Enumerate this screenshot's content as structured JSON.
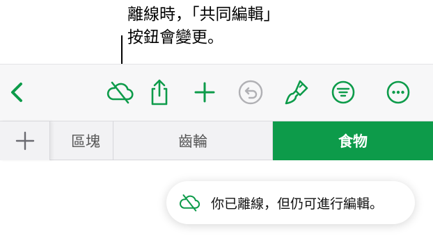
{
  "callout": {
    "line1": "離線時，「共同編輯」",
    "line2": "按鈕會變更。"
  },
  "toolbar": {
    "icons": {
      "back": "chevron-left-icon",
      "collaborate_offline": "cloud-slash-icon",
      "share": "share-icon",
      "add": "plus-icon",
      "undo": "undo-icon",
      "format": "paintbrush-icon",
      "organize": "filter-lines-icon",
      "more": "ellipsis-circle-icon"
    },
    "accent_color": "#0d9b4a",
    "disabled_color": "#b0b0b4"
  },
  "tabs": {
    "add_icon": "plus-icon",
    "items": [
      {
        "label": "區塊",
        "partial": true
      },
      {
        "label": "齒輪"
      },
      {
        "label": "食物",
        "selected": true
      }
    ]
  },
  "toast": {
    "icon": "cloud-slash-icon",
    "message": "你已離線，但仍可進行編輯。"
  }
}
